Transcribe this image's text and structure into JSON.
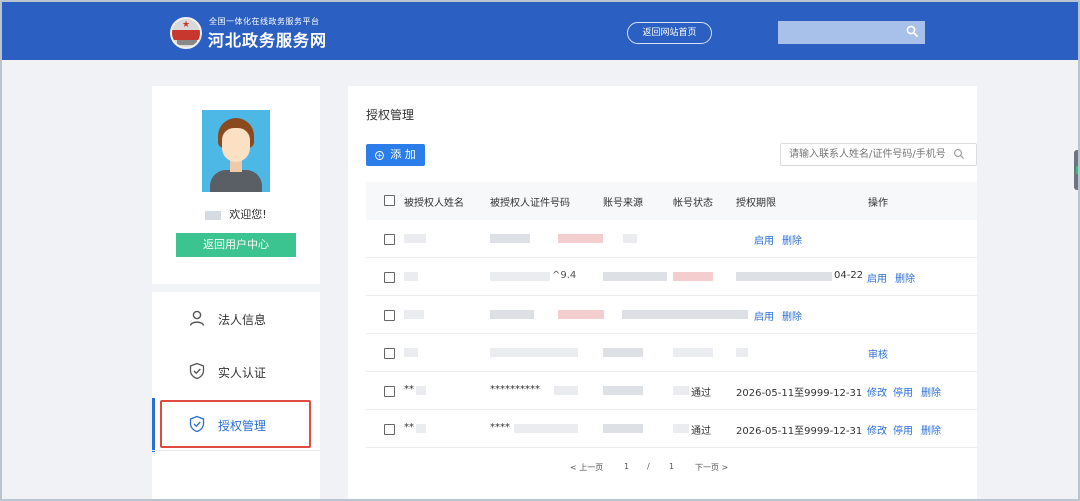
{
  "header": {
    "brand_subtitle": "全国一体化在线政务服务平台",
    "brand_title": "河北政务服务网",
    "home_button": "返回网站首页",
    "search_value": ""
  },
  "profile": {
    "welcome_text": "欢迎您!",
    "back_button": "返回用户中心"
  },
  "nav": {
    "items": [
      {
        "label": "法人信息",
        "icon": "person-icon"
      },
      {
        "label": "实人认证",
        "icon": "shield-check-icon"
      },
      {
        "label": "授权管理",
        "icon": "shield-check-icon",
        "active": true
      }
    ]
  },
  "main": {
    "title": "授权管理",
    "add_button": "添 加",
    "query_placeholder": "请输入联系人姓名/证件号码/手机号",
    "columns": [
      "被授权人姓名",
      "被授权人证件号码",
      "账号来源",
      "帐号状态",
      "授权期限",
      "操作"
    ],
    "rows": [
      {
        "name": "",
        "id": "",
        "source": "",
        "status": "",
        "period": "",
        "actions": [
          "启用",
          "删除"
        ]
      },
      {
        "name": "",
        "id_tail": "^9.4",
        "source": "",
        "status": "",
        "period": "04-22",
        "actions": [
          "启用",
          "删除"
        ]
      },
      {
        "name": "",
        "id": "",
        "source": "",
        "status": "",
        "period": "",
        "actions": [
          "启用",
          "删除"
        ]
      },
      {
        "name": "",
        "id": "",
        "source": "",
        "status": "",
        "period": "",
        "actions": [
          "审核"
        ]
      },
      {
        "name": "**",
        "id": "**********",
        "source": "",
        "status": "通过",
        "period": "2026-05-11至9999-12-31",
        "actions": [
          "修改",
          "停用",
          "删除"
        ]
      },
      {
        "name": "**",
        "id": "****",
        "source": "",
        "status": "通过",
        "period": "2026-05-11至9999-12-31",
        "actions": [
          "修改",
          "停用",
          "删除"
        ]
      }
    ]
  },
  "pager": {
    "prev": "< 上一页",
    "current": "1",
    "sep": "/",
    "total": "1",
    "next": "下一页 >"
  },
  "colors": {
    "header_bg": "#2b5fc2",
    "accent": "#2b7de9",
    "green_button": "#3bc48f",
    "highlight": "#e04b3f"
  }
}
